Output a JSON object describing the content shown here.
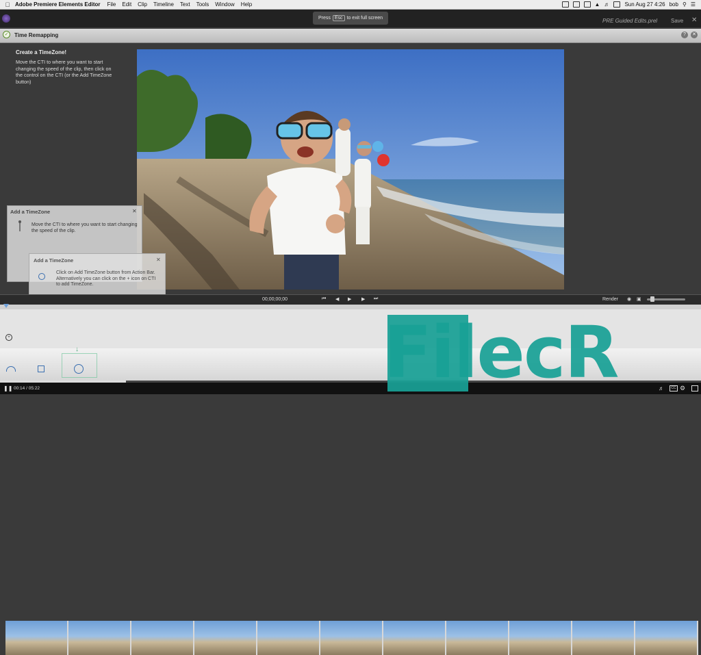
{
  "menubar": {
    "app_name": "Adobe Premiere Elements Editor",
    "items": [
      "File",
      "Edit",
      "Clip",
      "Timeline",
      "Text",
      "Tools",
      "Window",
      "Help"
    ],
    "datetime": "Sun Aug 27  4:26",
    "user": "bob"
  },
  "header": {
    "fullscreen_hint_prefix": "Press",
    "fullscreen_hint_key": "Esc",
    "fullscreen_hint_suffix": "to exit full screen",
    "project_name": "PRE Guided Edits.prel",
    "save_label": "Save"
  },
  "panel": {
    "title": "Time Remapping",
    "instructions_title": "Create a TimeZone!",
    "instructions_body": "Move the CTI to where you want to start changing the speed of the clip, then click on the control on the CTI (or the Add TimeZone button)"
  },
  "dialog1": {
    "title": "Add a TimeZone",
    "text": "Move the CTI to where you want to start changing the speed of the clip."
  },
  "dialog2": {
    "title": "Add a TimeZone",
    "text": "Click on Add TimeZone button from Action Bar. Alternatively you can click on the + icon on CTI to add TimeZone."
  },
  "transport": {
    "timecode": "00;00;00;00",
    "render_label": "Render"
  },
  "player": {
    "current_time": "00:14",
    "total_time": "05:22",
    "progress_fraction": 0.18
  },
  "watermark": {
    "text": "FilecR"
  },
  "colors": {
    "accent_blue": "#3a6fb0",
    "watermark_teal": "#19a096",
    "title_green": "#5a8c2a"
  }
}
